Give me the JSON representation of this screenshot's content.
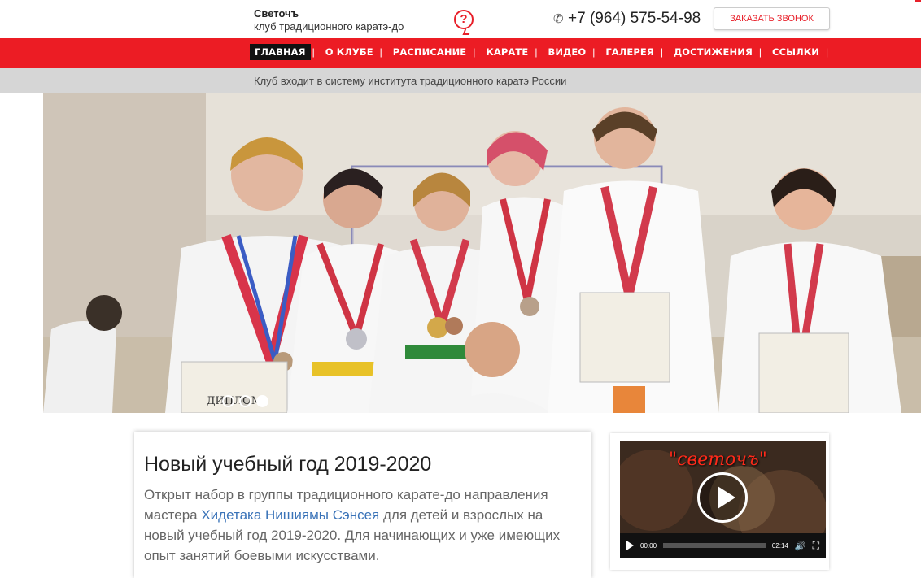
{
  "header": {
    "brand_name": "Светочъ",
    "brand_subtitle": "клуб традиционного каратэ-до",
    "help_icon_glyph": "?",
    "phone": "+7 (964) 575-54-98",
    "phone_icon": "phone-icon",
    "callback_button": "ЗАКАЗАТЬ ЗВОНОК"
  },
  "nav": {
    "items": [
      {
        "label": "ГЛАВНАЯ"
      },
      {
        "label": "О КЛУБЕ"
      },
      {
        "label": "РАСПИСАНИЕ"
      },
      {
        "label": "КАРАТЕ"
      },
      {
        "label": "ВИДЕО"
      },
      {
        "label": "ГАЛЕРЕЯ"
      },
      {
        "label": "ДОСТИЖЕНИЯ"
      },
      {
        "label": "ССЫЛКИ"
      }
    ],
    "separator": "|"
  },
  "infobar": {
    "text": "Клуб входит в систему института традиционного каратэ России"
  },
  "slider": {
    "diploma_text": "ДИПЛОМ",
    "slide_count": 3,
    "active_slide": 3
  },
  "article": {
    "title": "Новый учебный год 2019-2020",
    "body_start": "Открыт набор в группы традиционного карате-до направления мастера ",
    "link": "Хидетака Нишиямы Сэнсея",
    "body_end": " для детей и взрослых на новый учебный год 2019-2020.  Для начинающих и уже имеющих опыт занятий боевыми искусствами."
  },
  "video": {
    "overlay_title": "\"светочъ\"",
    "current_time": "00:00",
    "duration": "02:14"
  },
  "colors": {
    "accent": "#ec1c24",
    "link": "#3a73b8",
    "infobar": "#d6d6d6"
  }
}
